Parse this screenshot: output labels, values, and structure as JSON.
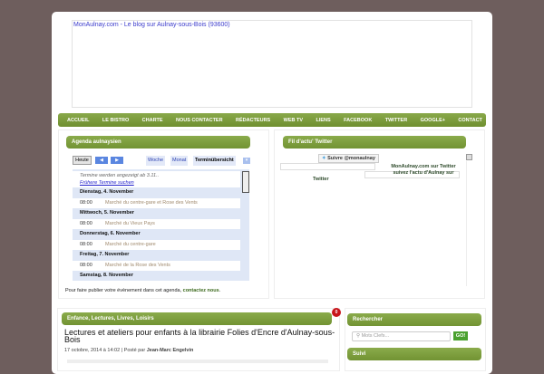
{
  "header": {
    "title": "MonAulnay.com - Le blog sur Aulnay-sous-Bois (93600)"
  },
  "nav": [
    "ACCUEIL",
    "LE BISTRO",
    "CHARTE",
    "NOUS CONTACTER",
    "RÉDACTEURS",
    "WEB TV",
    "LIENS",
    "FACEBOOK",
    "TWITTER",
    "GOOGLE+",
    "CONTACT"
  ],
  "agenda": {
    "title": "Agenda aulnaysien",
    "today": "Heute",
    "prev": "◀",
    "next": "▶",
    "week": "Woche",
    "month": "Monat",
    "overview": "Terminübersicht",
    "notice": "Termine werden angezeigt ab 3.11..",
    "earlier": "Frühere Termine suchen",
    "days": [
      {
        "day": "Dienstag, 4. November",
        "time": "08:00",
        "event": "Marché du centre-gare et Rose des Vents"
      },
      {
        "day": "Mittwoch, 5. November",
        "time": "08:00",
        "event": "Marché du Vieux Pays"
      },
      {
        "day": "Donnerstag, 6. November",
        "time": "08:00",
        "event": "Marché du centre-gare"
      },
      {
        "day": "Freitag, 7. November",
        "time": "08:00",
        "event": "Marché de la Rose des Vents"
      },
      {
        "day": "Samstag, 8. November"
      }
    ],
    "footer": "Pour faire publier votre évènement dans cet agenda,",
    "footer_link": "contactez nous",
    "footer_end": "."
  },
  "twitter": {
    "title": "Fil d'actu' Twitter",
    "follow": "Suivre @monaulnay",
    "heading": "MonAulnay.com sur Twitter",
    "sub": "suivez l'actu d'Aulnay sur",
    "label": "Twitter"
  },
  "post": {
    "category": "Enfance, Lectures, Livres, Loisirs",
    "comments": "0",
    "title": "Lectures et ateliers pour enfants à la librairie Folies d'Encre d'Aulnay-sous-Bois",
    "date": "17 octobre, 2014 à 14:02 | Posté par",
    "author": "Jean-Marc Engelvin"
  },
  "search": {
    "title": "Rechercher",
    "placeholder": "Mots Clefs...",
    "go": "GO!"
  },
  "follow": {
    "title": "Suivi"
  }
}
